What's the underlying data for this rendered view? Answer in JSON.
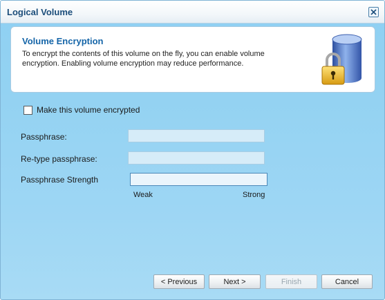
{
  "window": {
    "title": "Logical Volume"
  },
  "header": {
    "title": "Volume Encryption",
    "description": "To encrypt the contents of this volume on the fly, you can enable volume encryption. Enabling volume encryption may reduce performance.",
    "icon": "database-lock-icon"
  },
  "form": {
    "encrypt_checkbox": {
      "label": "Make this volume encrypted",
      "checked": false
    },
    "passphrase": {
      "label": "Passphrase:",
      "value": ""
    },
    "retype": {
      "label": "Re-type passphrase:",
      "value": ""
    },
    "strength": {
      "label": "Passphrase Strength",
      "weak_label": "Weak",
      "strong_label": "Strong",
      "level": 0
    }
  },
  "buttons": {
    "previous": "< Previous",
    "next": "Next >",
    "finish": "Finish",
    "cancel": "Cancel"
  },
  "colors": {
    "accent": "#1565a8",
    "background": "#93d2f2"
  }
}
